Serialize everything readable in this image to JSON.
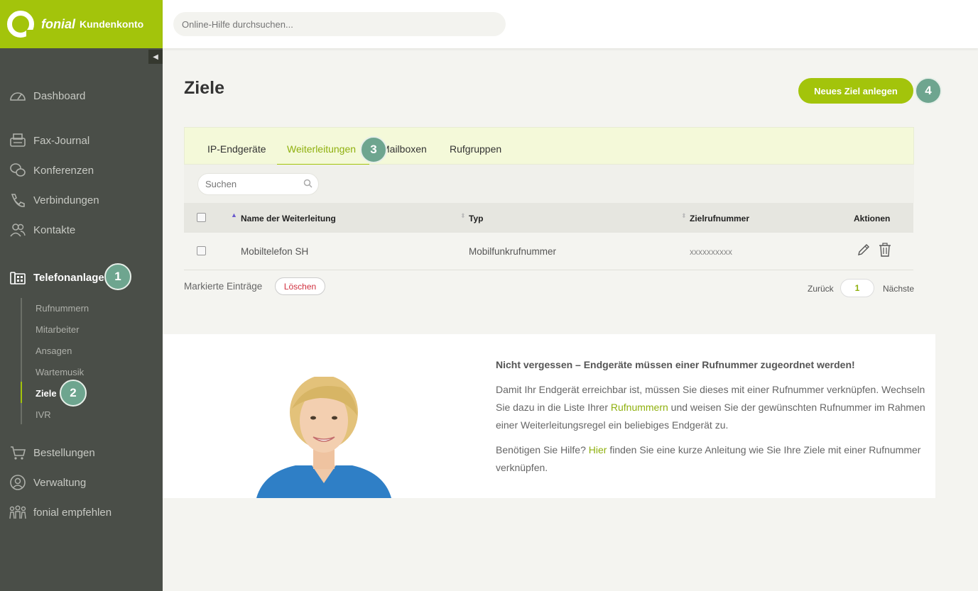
{
  "brand": {
    "name": "fonial",
    "sub": "Kundenkonto",
    "color": "#a3c40b"
  },
  "search": {
    "placeholder": "Online-Hilfe durchsuchen..."
  },
  "sidebar": {
    "items": [
      {
        "label": "Dashboard",
        "icon": "speedometer-icon"
      },
      {
        "label": "Fax-Journal",
        "icon": "fax-icon"
      },
      {
        "label": "Konferenzen",
        "icon": "chat-bubbles-icon"
      },
      {
        "label": "Verbindungen",
        "icon": "phone-icon"
      },
      {
        "label": "Kontakte",
        "icon": "people-icon"
      },
      {
        "label": "Telefonanlage",
        "icon": "office-phone-icon",
        "active": true
      },
      {
        "label": "Bestellungen",
        "icon": "cart-icon"
      },
      {
        "label": "Verwaltung",
        "icon": "user-circle-icon"
      },
      {
        "label": "fonial empfehlen",
        "icon": "group-icon"
      }
    ],
    "sub_items": [
      "Rufnummern",
      "Mitarbeiter",
      "Ansagen",
      "Wartemusik",
      "Ziele",
      "IVR"
    ],
    "active_sub": "Ziele"
  },
  "steps": [
    "1",
    "2",
    "3",
    "4"
  ],
  "page": {
    "title": "Ziele",
    "new_button": "Neues Ziel anlegen"
  },
  "tabs": [
    {
      "label": "IP-Endgeräte"
    },
    {
      "label": "Weiterleitungen",
      "active": true
    },
    {
      "label": "Mailboxen"
    },
    {
      "label": "Rufgruppen"
    }
  ],
  "filter": {
    "placeholder": "Suchen"
  },
  "table": {
    "columns": [
      "Name der Weiterleitung",
      "Typ",
      "Zielrufnummer",
      "Aktionen"
    ],
    "rows": [
      {
        "name": "Mobiltelefon SH",
        "type": "Mobilfunkrufnummer",
        "target": "xxxxxxxxxx"
      }
    ]
  },
  "bulk": {
    "label": "Markierte Einträge",
    "delete": "Löschen"
  },
  "pagination": {
    "prev": "Zurück",
    "current": "1",
    "next": "Nächste"
  },
  "info": {
    "title": "Nicht vergessen – Endgeräte müssen einer Rufnummer zugeordnet werden!",
    "p1_a": "Damit Ihr Endgerät erreichbar ist, müssen Sie dieses mit einer Rufnummer verknüpfen. Wechseln Sie dazu in die Liste Ihrer ",
    "p1_link": "Rufnummern",
    "p1_b": " und weisen Sie der gewünschten Rufnummer im Rahmen einer Weiterleitungsregel ein beliebiges Endgerät zu.",
    "p2_a": "Benötigen Sie Hilfe? ",
    "p2_link": "Hier",
    "p2_b": " finden Sie eine kurze Anleitung wie Sie Ihre Ziele mit einer Rufnummer verknüpfen."
  }
}
